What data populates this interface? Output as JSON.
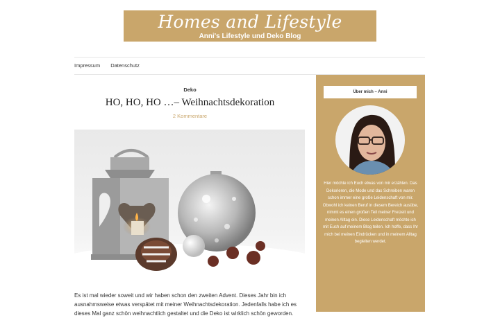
{
  "site": {
    "title": "Homes and Lifestyle",
    "tagline": "Anni's Lifestyle und Deko Blog"
  },
  "nav": {
    "items": [
      "Impressum",
      "Datenschutz"
    ]
  },
  "post": {
    "category": "Deko",
    "title": "HO, HO, HO …– Weihnachtsdekoration",
    "comments": "2 Kommentare",
    "image_icon": "christmas-lantern-ornament-photo",
    "lines": [
      "Es ist mal wieder soweit und wir haben schon den zweiten Advent. Dieses  Jahr bin ich",
      "ausnahmsweise etwas verspätet mit meiner Weihnachtsdekoration. Jedenfalls habe ich es",
      "dieses Mal ganz schön weihnachtlich gestaltet und die Deko ist wirklich schön geworden."
    ]
  },
  "sidebar": {
    "heading": "Über mich – Anni",
    "text": "Hier möchte ich Euch etwas von mir erzählen. Das Dekorieren, die Mode und das Schreiben waren schon immer eine große Leidenschaft von mir. Obwohl ich keinen Beruf in diesem Bereich ausübe, nimmt es einen großen Teil meiner Freizeit und meinen Alltag ein. Diese Leidenschaft möchte ich mit Euch auf meinem Blog teilen. Ich hoffe, dass Ihr mich bei meinen Eindrücken und in meinem Alltag begleiten werdet."
  },
  "colors": {
    "accent": "#c9a66b",
    "text": "#333333"
  }
}
